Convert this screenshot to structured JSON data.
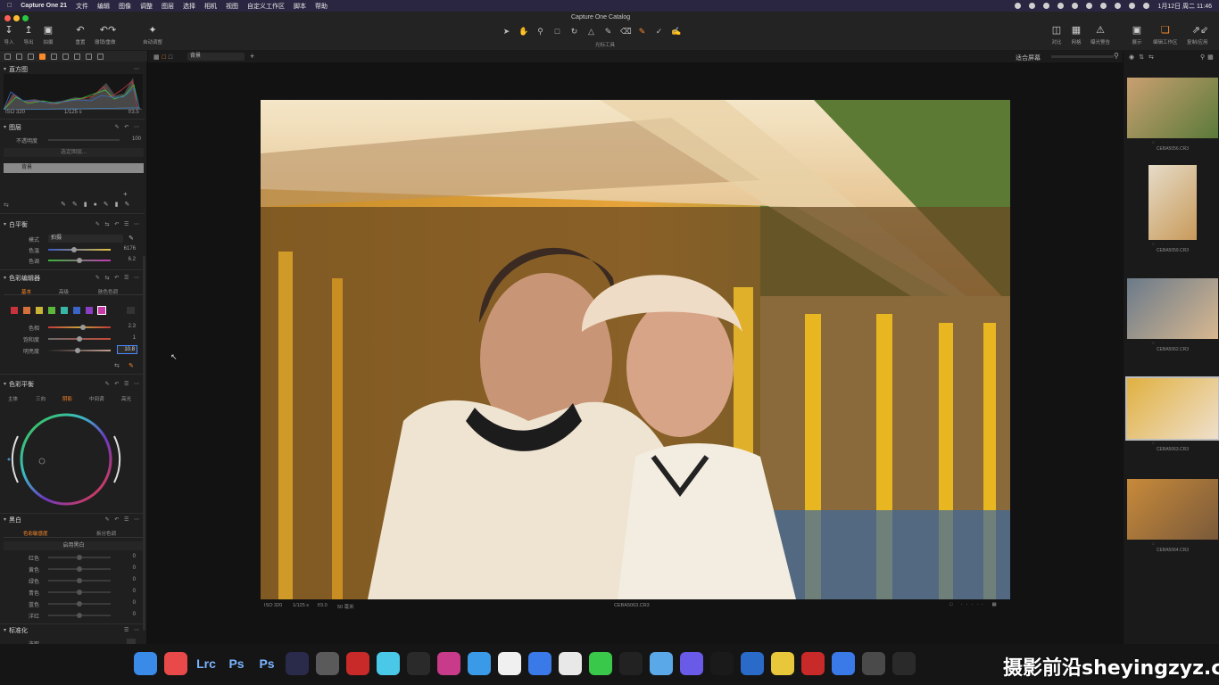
{
  "menubar": {
    "app_name": "Capture One 21",
    "items": [
      "文件",
      "编辑",
      "图像",
      "调整",
      "图层",
      "选择",
      "相机",
      "视图",
      "自定义工作区",
      "脚本",
      "帮助"
    ],
    "clock": "1月12日 周二 11:46"
  },
  "window": {
    "title": "Capture One Catalog"
  },
  "toolbar": {
    "left_buttons": [
      "导入",
      "导出",
      "拍摄",
      "重置",
      "撤销/重做",
      "自动调整"
    ],
    "cursor_tools_label": "光标工具",
    "right_buttons": [
      "对比",
      "网格",
      "曝光警告",
      "展示",
      "编辑工作区",
      "复制/应用"
    ]
  },
  "viewer_bar": {
    "layer": "背景",
    "fit": "适合屏幕"
  },
  "histogram": {
    "title": "直方图",
    "iso": "ISO 320",
    "shutter": "1/125 s",
    "aperture": "f/3.5"
  },
  "layers": {
    "title": "图层",
    "opacity_label": "不透明度",
    "opacity_value": "100",
    "button": "选定图层...",
    "background_layer": "背景"
  },
  "white_balance": {
    "title": "白平衡",
    "mode_label": "模式",
    "mode_value": "拍摄",
    "kelvin_label": "色温",
    "kelvin_value": "6176",
    "tint_label": "色调",
    "tint_value": "6.2"
  },
  "color_editor": {
    "title": "色彩编辑器",
    "tabs": [
      "基本",
      "高级",
      "肤色色调"
    ],
    "active_tab": "基本",
    "swatches": [
      "#c8333b",
      "#d6703a",
      "#c9b436",
      "#5fb63d",
      "#39b6a6",
      "#3a64c8",
      "#8a3ec2",
      "#c83aa7"
    ],
    "hue_label": "色相",
    "hue_value": "2.3",
    "saturation_label": "饱和度",
    "saturation_value": "1",
    "lightness_label": "明亮度",
    "lightness_value": "10.8"
  },
  "color_balance": {
    "title": "色彩平衡",
    "tabs": [
      "主体",
      "三向",
      "阴影",
      "中间调",
      "高光"
    ],
    "active_tab": "阴影"
  },
  "black_white": {
    "title": "黑白",
    "tabs": [
      "色彩敏感度",
      "拆分色调"
    ],
    "enable_button": "启用黑白",
    "rows": [
      {
        "label": "红色",
        "value": "0"
      },
      {
        "label": "黄色",
        "value": "0"
      },
      {
        "label": "绿色",
        "value": "0"
      },
      {
        "label": "青色",
        "value": "0"
      },
      {
        "label": "蓝色",
        "value": "0"
      },
      {
        "label": "洋红",
        "value": "0"
      }
    ]
  },
  "normalize": {
    "title": "标准化",
    "pick_label": "选取"
  },
  "image_info": {
    "iso": "ISO 320",
    "shutter": "1/125 s",
    "aperture": "f/3.0",
    "focal": "50 毫米",
    "filename": "CEBA5063.CR3"
  },
  "thumbnails": [
    {
      "name": "CEBA5056.CR3",
      "selected": false
    },
    {
      "name": "CEBA5059.CR3",
      "selected": false
    },
    {
      "name": "CEBA5062.CR3",
      "selected": false
    },
    {
      "name": "CEBA5063.CR3",
      "selected": true
    },
    {
      "name": "CEBA5064.CR3",
      "selected": false
    }
  ],
  "dock": [
    "访达",
    "启动台",
    "Lrc",
    "Ps",
    "Ps",
    "1Password",
    "Rocket",
    "Capture",
    "Affinity",
    "DaVinci",
    "Final Cut",
    "Safari",
    "Photos",
    "App",
    "Chrome",
    "微信",
    "QQ",
    "Shortcuts",
    "Apps",
    "Prime",
    "Pilot",
    "Notes",
    "网易云音乐",
    "Finder",
    "Activity",
    "Clock"
  ],
  "watermark": "摄影前沿sheyingzyz.com"
}
